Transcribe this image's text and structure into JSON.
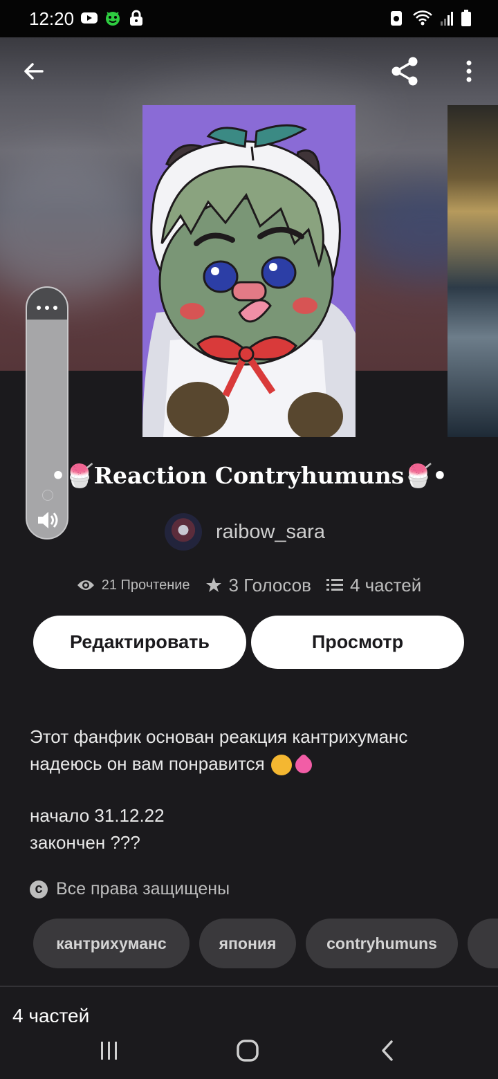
{
  "status_bar": {
    "time": "12:20",
    "left_icons": [
      "youtube-icon",
      "alien-app-icon",
      "lock-icon"
    ],
    "right_icons": [
      "battery-saver-icon",
      "wifi-icon",
      "signal-icon",
      "battery-icon"
    ]
  },
  "header": {
    "back_icon": "arrow-left-icon",
    "share_icon": "share-icon",
    "more_icon": "more-vertical-icon"
  },
  "story": {
    "title": "•🍧Reaction Contryhumuns🍧•",
    "author": "raibow_sara",
    "stats": {
      "reads": "21 Прочтение",
      "votes": "3 Голосов",
      "parts": "4 частей"
    }
  },
  "actions": {
    "edit_label": "Редактировать",
    "view_label": "Просмотр"
  },
  "description": {
    "line1": "Этот фанфик основан реакция кантрихуманс",
    "line2": "надеюсь он вам понравится",
    "line3": "начало 31.12.22",
    "line4": "закончен ???"
  },
  "rights": "Все права защищены",
  "tags": [
    "кантрихуманс",
    "япония",
    "contryhumuns"
  ],
  "parts_section": {
    "heading": "4 частей"
  },
  "volume_overlay": {
    "menu_icon": "more-horizontal-icon",
    "speaker_icon": "speaker-icon"
  },
  "nav": [
    "recent-apps-icon",
    "home-icon",
    "back-icon"
  ],
  "colors": {
    "background": "#1b1a1d",
    "button": "#ffffff",
    "tag": "#3a393c",
    "cover": "#8a6bd6"
  }
}
